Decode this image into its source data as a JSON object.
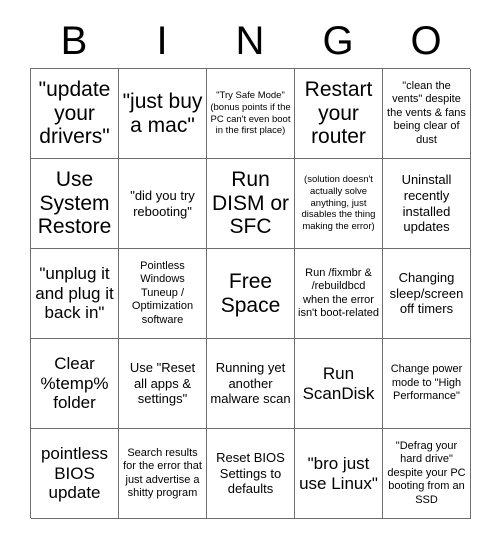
{
  "header": {
    "letters": [
      "B",
      "I",
      "N",
      "G",
      "O"
    ]
  },
  "grid": {
    "columns": 5,
    "rows": 5,
    "cells": [
      {
        "text": "\"update your drivers\"",
        "size": "xl"
      },
      {
        "text": "\"just buy a mac\"",
        "size": "xl"
      },
      {
        "text": "\"Try Safe Mode\" (bonus points if the PC can't even boot in the first place)",
        "size": "xs"
      },
      {
        "text": "Restart your router",
        "size": "xl"
      },
      {
        "text": "\"clean the vents\" despite the vents & fans being clear of dust",
        "size": "sm"
      },
      {
        "text": "Use System Restore",
        "size": "xl"
      },
      {
        "text": "\"did you try rebooting\"",
        "size": "md"
      },
      {
        "text": "Run DISM or SFC",
        "size": "xl"
      },
      {
        "text": "(solution doesn't actually solve anything, just disables the thing making the error)",
        "size": "xs"
      },
      {
        "text": "Uninstall recently installed updates",
        "size": "md"
      },
      {
        "text": "\"unplug it and plug it back in\"",
        "size": "lg"
      },
      {
        "text": "Pointless Windows Tuneup / Optimization software",
        "size": "sm"
      },
      {
        "text": "Free Space",
        "size": "xl"
      },
      {
        "text": "Run /fixmbr & /rebuildbcd when the error isn't boot-related",
        "size": "sm"
      },
      {
        "text": "Changing sleep/screen off timers",
        "size": "md"
      },
      {
        "text": "Clear %temp% folder",
        "size": "lg"
      },
      {
        "text": "Use \"Reset all apps & settings\"",
        "size": "md"
      },
      {
        "text": "Running yet another malware scan",
        "size": "md"
      },
      {
        "text": "Run ScanDisk",
        "size": "lg"
      },
      {
        "text": "Change power mode to \"High Performance\"",
        "size": "sm"
      },
      {
        "text": "pointless BIOS update",
        "size": "lg"
      },
      {
        "text": "Search results for the error that just advertise a shitty program",
        "size": "sm"
      },
      {
        "text": "Reset BIOS Settings to defaults",
        "size": "md"
      },
      {
        "text": "\"bro just use Linux\"",
        "size": "lg"
      },
      {
        "text": "\"Defrag your hard drive\" despite your PC booting from an SSD",
        "size": "sm"
      }
    ]
  },
  "colors": {
    "background": "#ffffff",
    "text": "#000000",
    "border": "#6e6e6e"
  }
}
